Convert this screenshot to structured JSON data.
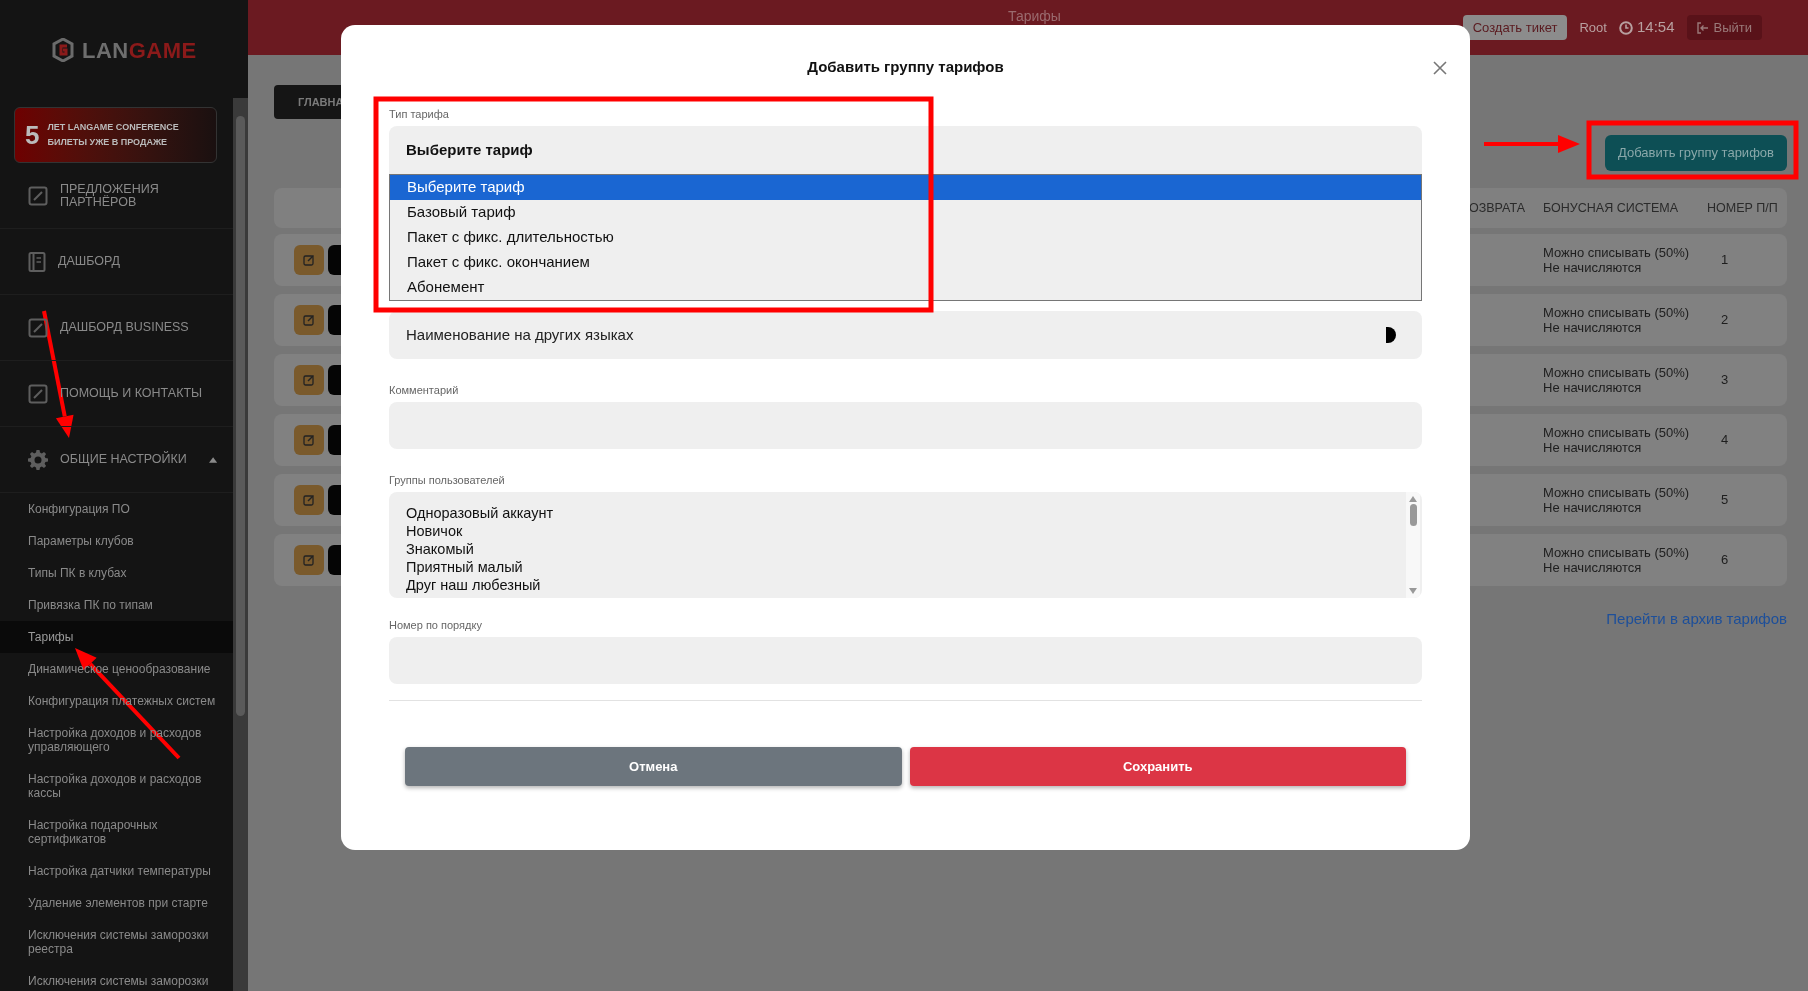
{
  "header": {
    "title": "Тарифы",
    "create_ticket": "Создать тикет",
    "user": "Root",
    "time": "14:54",
    "logout": "Выйти"
  },
  "sidebar": {
    "logo": {
      "part_1": "LAN",
      "part_2": "GAME"
    },
    "promo": {
      "number": "5",
      "line_1": "ЛЕТ LANGAME CONFERENCE",
      "line_2": "БИЛЕТЫ УЖЕ В ПРОДАЖЕ"
    },
    "items": [
      {
        "label": "ПРЕДЛОЖЕНИЯ ПАРТНЁРОВ",
        "kind": "link"
      },
      {
        "label": "ДАШБОРД",
        "kind": "link"
      },
      {
        "label": "ДАШБОРД BUSINESS",
        "kind": "link"
      },
      {
        "label": "ПОМОЩЬ И КОНТАКТЫ",
        "kind": "link"
      },
      {
        "label": "ОБЩИЕ НАСТРОЙКИ",
        "kind": "group",
        "expanded": true
      }
    ],
    "subitems": [
      {
        "label": "Конфигурация ПО",
        "selected": false
      },
      {
        "label": "Параметры клубов",
        "selected": false
      },
      {
        "label": "Типы ПК в клубах",
        "selected": false
      },
      {
        "label": "Привязка ПК по типам",
        "selected": false
      },
      {
        "label": "Тарифы",
        "selected": true
      },
      {
        "label": "Динамическое ценообразование",
        "selected": false
      },
      {
        "label": "Конфигурация платежных систем",
        "selected": false
      },
      {
        "label": "Настройка доходов и расходов управляющего",
        "selected": false
      },
      {
        "label": "Настройка доходов и расходов кассы",
        "selected": false
      },
      {
        "label": "Настройка подарочных сертификатов",
        "selected": false
      },
      {
        "label": "Настройка датчики температуры",
        "selected": false
      },
      {
        "label": "Удаление элементов при старте",
        "selected": false
      },
      {
        "label": "Исключения системы заморозки реестра",
        "selected": false
      },
      {
        "label": "Исключения системы заморозки",
        "selected": false
      }
    ]
  },
  "page": {
    "breadcrumb": "ГЛАВНА",
    "add_button": "Добавить группу тарифов",
    "table": {
      "columns": [
        "ОЗВРАТА",
        "БОНУСНАЯ СИСТЕМА",
        "НОМЕР П/П"
      ],
      "rows": [
        {
          "bonus_1": "Можно списывать (50%)",
          "bonus_2": "Не начисляются",
          "number": "1"
        },
        {
          "bonus_1": "Можно списывать (50%)",
          "bonus_2": "Не начисляются",
          "number": "2"
        },
        {
          "bonus_1": "Можно списывать (50%)",
          "bonus_2": "Не начисляются",
          "number": "3"
        },
        {
          "bonus_1": "Можно списывать (50%)",
          "bonus_2": "Не начисляются",
          "number": "4"
        },
        {
          "bonus_1": "Можно списывать (50%)",
          "bonus_2": "Не начисляются",
          "number": "5"
        },
        {
          "bonus_1": "Можно списывать (50%)",
          "bonus_2": "Не начисляются",
          "number": "6"
        }
      ]
    },
    "archive_link": "Перейти в архив тарифов"
  },
  "modal": {
    "title": "Добавить группу тарифов",
    "tariff_type": {
      "label": "Тип тарифа",
      "value": "Выберите тариф",
      "options": [
        {
          "label": "Выберите тариф",
          "selected": true
        },
        {
          "label": "Базовый тариф",
          "selected": false
        },
        {
          "label": "Пакет с фикс. длительностью",
          "selected": false
        },
        {
          "label": "Пакет с фикс. окончанием",
          "selected": false
        },
        {
          "label": "Абонемент",
          "selected": false
        }
      ]
    },
    "other_languages": {
      "label": "Наименование на других языках",
      "expanded": false
    },
    "comment": {
      "label": "Комментарий"
    },
    "user_groups": {
      "label": "Группы пользователей",
      "options": [
        "Одноразовый аккаунт",
        "Новичок",
        "Знакомый",
        "Приятный малый",
        "Друг наш любезный"
      ]
    },
    "order_number": {
      "label": "Номер по порядку"
    },
    "buttons": {
      "cancel": "Отмена",
      "save": "Сохранить"
    }
  }
}
